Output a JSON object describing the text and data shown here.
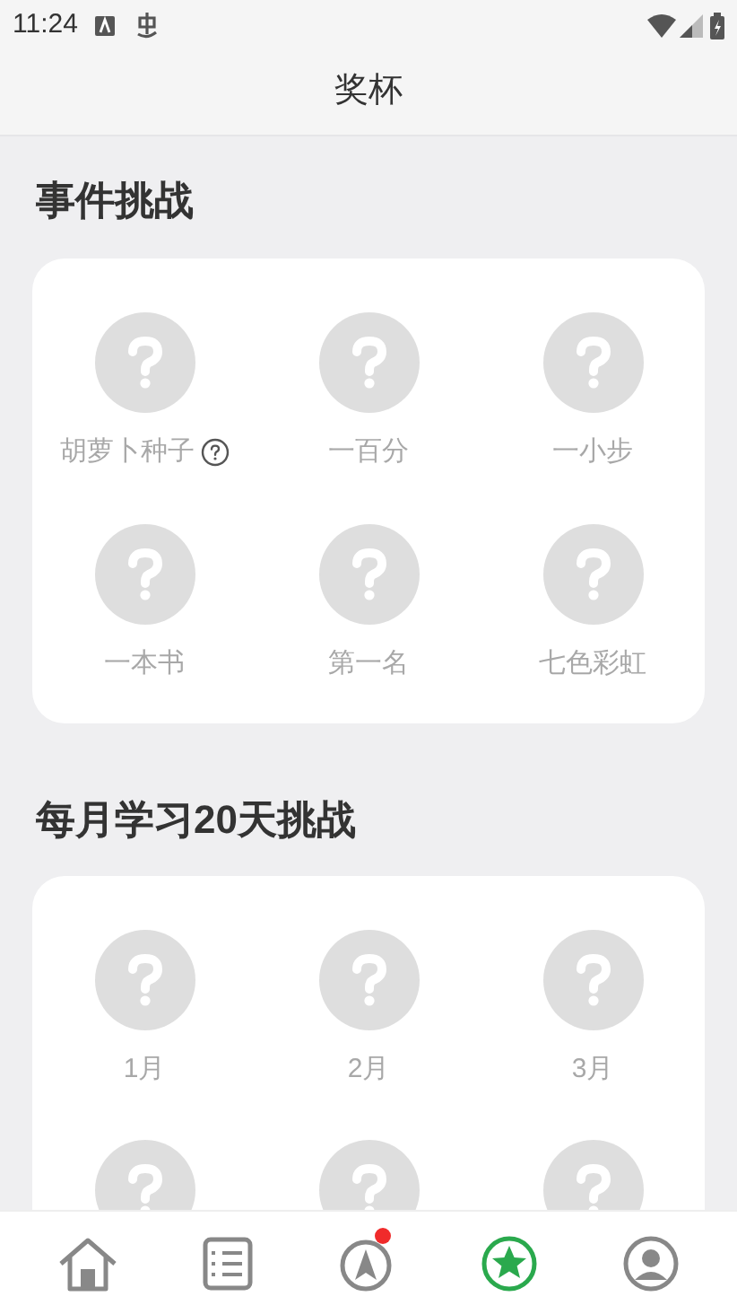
{
  "status_bar": {
    "time": "11:24"
  },
  "header": {
    "title": "奖杯"
  },
  "sections": [
    {
      "title": "事件挑战",
      "items": [
        {
          "label": "胡萝卜种子",
          "locked": true,
          "help": true
        },
        {
          "label": "一百分",
          "locked": true,
          "help": false
        },
        {
          "label": "一小步",
          "locked": true,
          "help": false
        },
        {
          "label": "一本书",
          "locked": true,
          "help": false
        },
        {
          "label": "第一名",
          "locked": true,
          "help": false
        },
        {
          "label": "七色彩虹",
          "locked": true,
          "help": false
        }
      ]
    },
    {
      "title": "每月学习20天挑战",
      "items": [
        {
          "label": "1月",
          "locked": true,
          "help": false
        },
        {
          "label": "2月",
          "locked": true,
          "help": false
        },
        {
          "label": "3月",
          "locked": true,
          "help": false
        },
        {
          "locked": true,
          "help": false
        },
        {
          "locked": true,
          "help": false
        },
        {
          "locked": true,
          "help": false
        }
      ]
    }
  ],
  "bottom_nav": [
    {
      "kind": "home",
      "selected": false,
      "badge": false
    },
    {
      "kind": "list",
      "selected": false,
      "badge": false
    },
    {
      "kind": "compass",
      "selected": false,
      "badge": true
    },
    {
      "kind": "star",
      "selected": true,
      "badge": false
    },
    {
      "kind": "profile",
      "selected": false,
      "badge": false
    }
  ]
}
